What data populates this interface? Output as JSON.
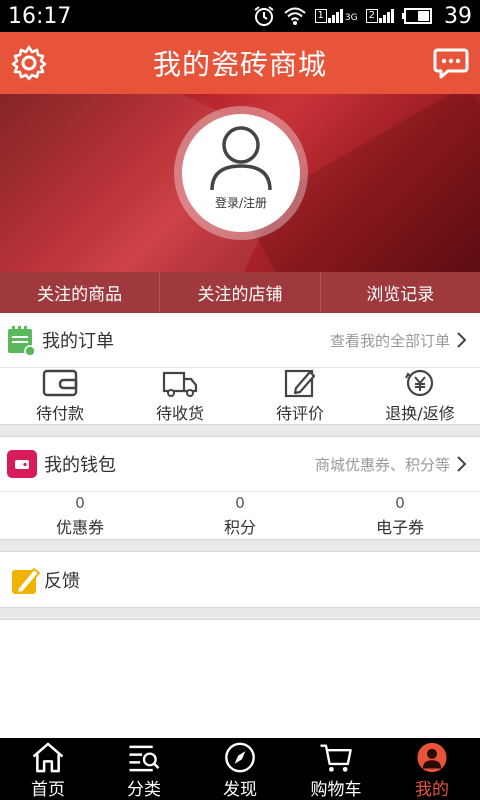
{
  "status_bar": {
    "time": "16:17",
    "sim1": "1",
    "sim2": "2",
    "network": "3G",
    "battery": "39"
  },
  "header": {
    "title": "我的瓷砖商城"
  },
  "profile": {
    "login_label": "登录/注册"
  },
  "follow_tabs": [
    "关注的商品",
    "关注的店铺",
    "浏览记录"
  ],
  "orders": {
    "title": "我的订单",
    "view_all": "查看我的全部订单",
    "items": [
      "待付款",
      "待收货",
      "待评价",
      "退换/返修"
    ]
  },
  "wallet": {
    "title": "我的钱包",
    "hint": "商城优惠券、积分等",
    "items": [
      {
        "value": "0",
        "label": "优惠券"
      },
      {
        "value": "0",
        "label": "积分"
      },
      {
        "value": "0",
        "label": "电子券"
      }
    ]
  },
  "feedback": {
    "title": "反馈"
  },
  "bottom_nav": {
    "items": [
      "首页",
      "分类",
      "发现",
      "购物车",
      "我的"
    ],
    "active_index": 4
  },
  "colors": {
    "accent": "#e8543a",
    "order_icon": "#5cb85c",
    "wallet_icon": "#d81b5a",
    "feedback_icon": "#f0b400"
  }
}
